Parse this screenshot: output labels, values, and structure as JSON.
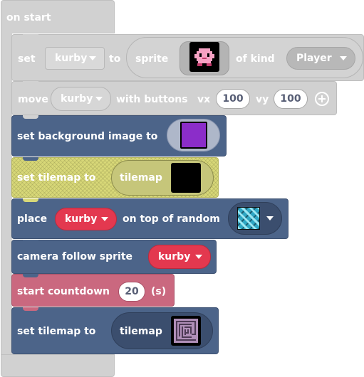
{
  "on_start": {
    "label": "on start"
  },
  "set_sprite": {
    "set_label": "set",
    "variable": "kurby",
    "to_label": "to",
    "sprite_label": "sprite",
    "of_kind_label": "of kind",
    "kind": "Player"
  },
  "move": {
    "move_label": "move",
    "variable": "kurby",
    "with_buttons_label": "with buttons",
    "vx_label": "vx",
    "vx": "100",
    "vy_label": "vy",
    "vy": "100",
    "expand_icon": "plus-circle-icon"
  },
  "background": {
    "label": "set background image to",
    "image_color": "#8b2dc9"
  },
  "tilemap1": {
    "label": "set tilemap to",
    "tilemap_label": "tilemap",
    "preview": "black-square"
  },
  "place": {
    "place_label": "place",
    "variable": "kurby",
    "on_top_label": "on top of random",
    "tile_icon": "tile-pattern-icon"
  },
  "camera": {
    "label": "camera follow sprite",
    "variable": "kurby"
  },
  "countdown": {
    "label": "start countdown",
    "value": "20",
    "unit": "(s)"
  },
  "tilemap2": {
    "label": "set tilemap to",
    "tilemap_label": "tilemap",
    "preview": "maze-icon"
  },
  "colors": {
    "disabled_gray": "#d0d0d0",
    "scene_blue": "#4c6489",
    "variable_red": "#e3384f",
    "info_pink": "#ca687f",
    "tilemap_yellow": "#d8d878"
  }
}
